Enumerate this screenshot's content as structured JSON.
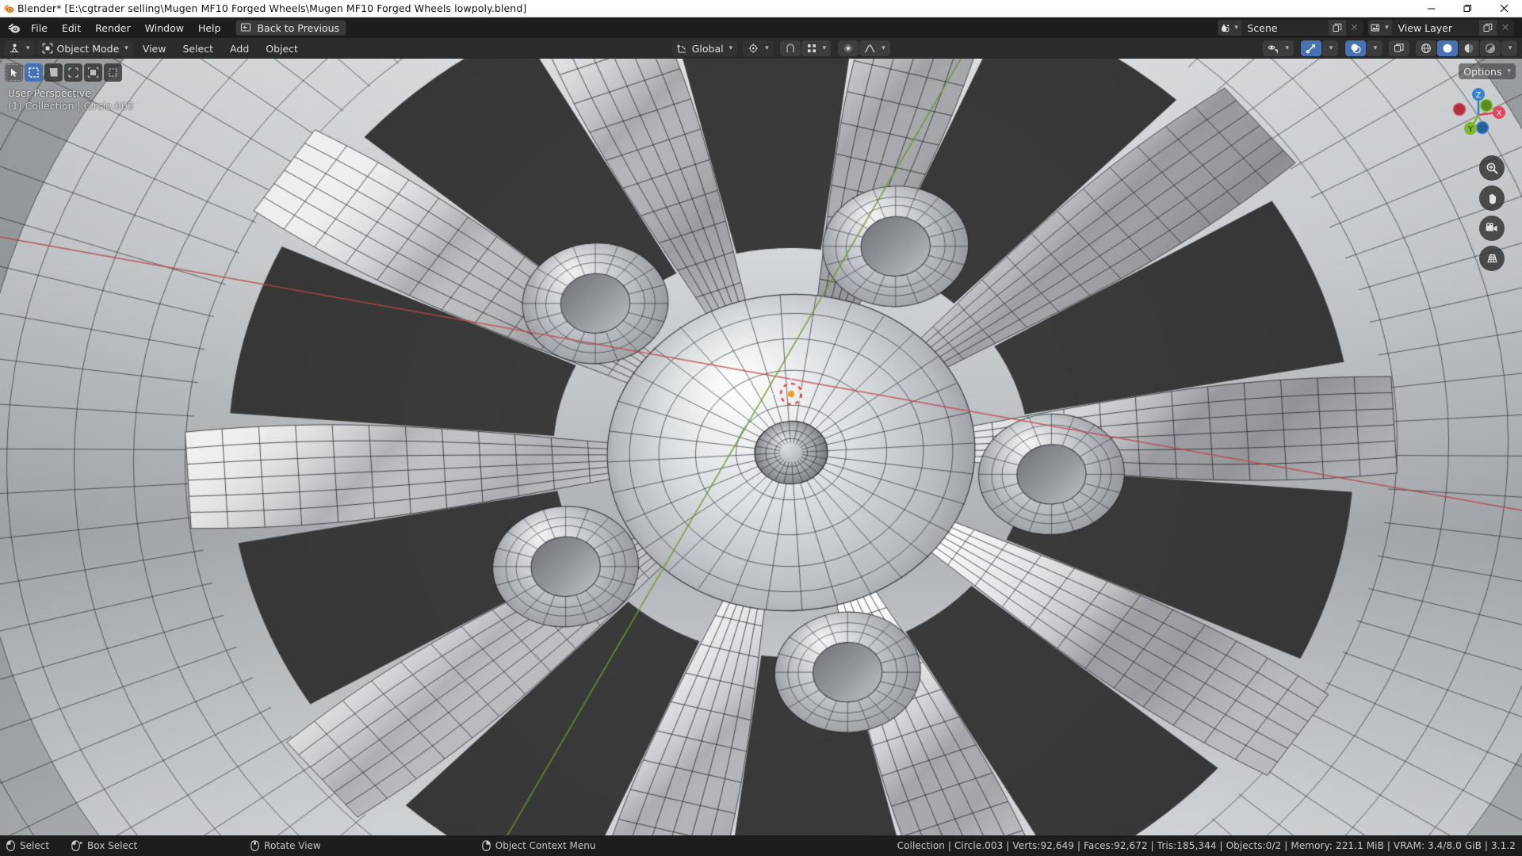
{
  "window": {
    "title": "Blender* [E:\\cgtrader selling\\Mugen MF10 Forged Wheels\\Mugen MF10 Forged Wheels lowpoly.blend]",
    "app_icon": "blender-logo-icon",
    "minimize": "—",
    "maximize": "❐",
    "close": "✕"
  },
  "topbar": {
    "logo": "blender-logo-icon",
    "menus": [
      {
        "label": "File"
      },
      {
        "label": "Edit"
      },
      {
        "label": "Render"
      },
      {
        "label": "Window"
      },
      {
        "label": "Help"
      }
    ],
    "back_to_previous": "Back to Previous",
    "scene": {
      "icon": "scene-icon",
      "name": "Scene",
      "new_icon": "duplicate-icon",
      "unlink_icon": "✕"
    },
    "view_layer": {
      "icon": "view-layer-icon",
      "name": "View Layer",
      "new_icon": "duplicate-icon",
      "unlink_icon": "✕"
    }
  },
  "tool_header": {
    "editor_type": "editor-type-3dview",
    "mode": "Object Mode",
    "menus": [
      {
        "label": "View"
      },
      {
        "label": "Select"
      },
      {
        "label": "Add"
      },
      {
        "label": "Object"
      }
    ],
    "transform_orientation": "Global",
    "snap_icon": "magnet-icon",
    "proportional_icon": "proportional-edit-icon",
    "pivot_icon": "pivot-point-icon",
    "snapping_icon": "snap-grid-icon",
    "falloff_icon": "falloff-curve-icon",
    "right": {
      "visibility_icon": "eye-cursor-icon",
      "gizmo_icon": "gizmo-arrow-icon",
      "overlays_icon": "overlays-icon",
      "xray_icon": "xray-icon",
      "shading_wireframe": "wireframe-sphere-icon",
      "shading_solid": "solid-sphere-icon",
      "shading_material": "material-preview-icon",
      "shading_rendered": "rendered-icon"
    }
  },
  "toolbar": {
    "tools": [
      {
        "name": "tweak-tool",
        "state": "selected"
      },
      {
        "name": "select-box-tool",
        "state": "active"
      },
      {
        "name": "select-circle-tool",
        "state": "normal"
      },
      {
        "name": "select-lasso-tool",
        "state": "normal"
      },
      {
        "name": "cursor-tool",
        "state": "normal"
      },
      {
        "name": "move-tool",
        "state": "normal"
      }
    ]
  },
  "viewport": {
    "view_name": "User Perspective",
    "context": "(1) Collection | Circle.003",
    "options_label": "Options",
    "gizmo": {
      "axis_x": "X",
      "axis_y": "Y",
      "axis_z": "Z",
      "color_x": "#e04860",
      "color_y": "#7db82b",
      "color_z": "#3281d5"
    },
    "nav_buttons": [
      {
        "name": "zoom-icon"
      },
      {
        "name": "pan-hand-icon"
      },
      {
        "name": "camera-view-icon"
      },
      {
        "name": "toggle-perspective-icon"
      }
    ],
    "scene_description": "Shaded 3D view of a Mugen MF10 forged alloy wheel rim with wireframe overlay, viewed at an angle from inside the rim barrel",
    "colors": {
      "background": "#3c3c3c",
      "metal_light": "#e8e9ea",
      "metal_mid": "#b9bcc0",
      "metal_dark": "#7d8084",
      "wire": "#202227",
      "axis_x_line": "#c14a4a",
      "axis_y_line": "#6a9b2e",
      "cursor_red": "#e44a4a",
      "cursor_orange": "#ff9b1e"
    }
  },
  "status_bar": {
    "hints": [
      {
        "icon": "mouse-left-icon",
        "label": "Select"
      },
      {
        "icon": "mouse-left-drag-icon",
        "label": "Box Select"
      },
      {
        "icon": "mouse-middle-icon",
        "label": "Rotate View"
      },
      {
        "icon": "mouse-right-icon",
        "label": "Object Context Menu"
      }
    ],
    "stats": "Collection | Circle.003 | Verts:92,649 | Faces:92,672 | Tris:185,344 | Objects:0/2 | Memory: 221.1 MiB | VRAM: 3.4/8.0 GiB | 3.1.2"
  }
}
